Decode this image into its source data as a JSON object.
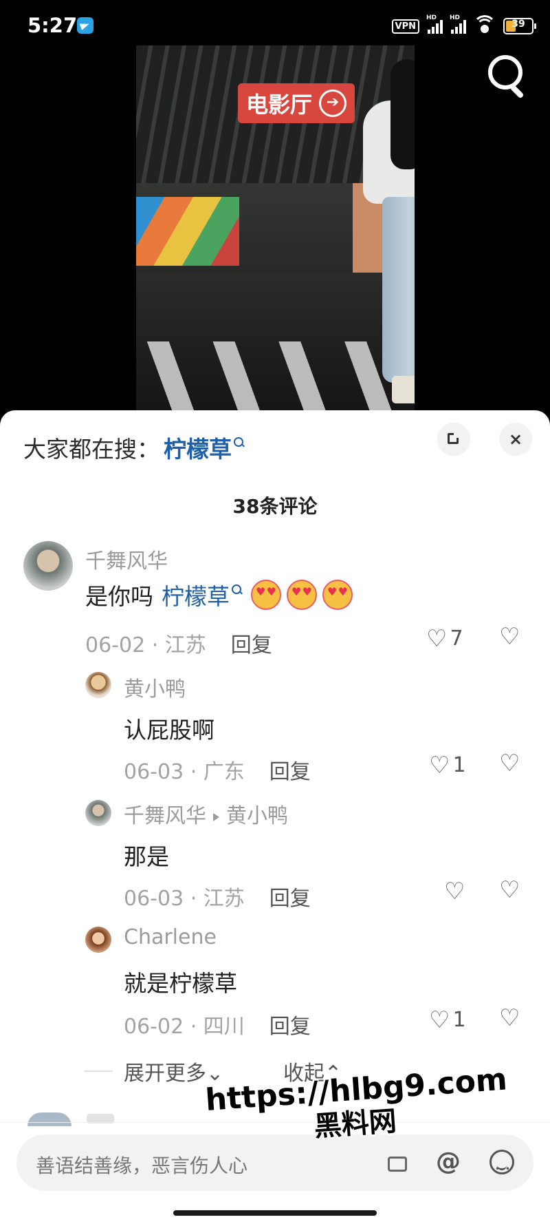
{
  "status_bar": {
    "time": "5:27",
    "vpn": "VPN",
    "hd": "HD",
    "battery": "39"
  },
  "video": {
    "sign_text": "电影厅",
    "sign_arrow": "➔"
  },
  "hot_search": {
    "prefix": "大家都在搜：",
    "term": "柠檬草"
  },
  "comments_header": {
    "count_label": "38条评论"
  },
  "comments": [
    {
      "author": "千舞风华",
      "text": "是你吗",
      "link": "柠檬草",
      "meta": "06-02 · 江苏",
      "reply": "回复",
      "likes": "7",
      "emoji_count": 3
    },
    {
      "author": "黄小鸭",
      "text": "认屁股啊",
      "meta": "06-03 · 广东",
      "reply": "回复",
      "likes": "1"
    },
    {
      "author": "千舞风华",
      "reply_to": "黄小鸭",
      "text": "那是",
      "meta": "06-03 · 江苏",
      "reply": "回复",
      "likes": ""
    },
    {
      "author": "Charlene",
      "text": "就是柠檬草",
      "meta": "06-02 · 四川",
      "reply": "回复",
      "likes": "1"
    }
  ],
  "thread_controls": {
    "expand_more": "展开更多⌄",
    "collapse": "收起⌃"
  },
  "input": {
    "placeholder": "善语结善缘，恶言伤人心",
    "at": "@"
  },
  "watermark": {
    "url": "https://hlbg9.com",
    "name": "黑料网"
  },
  "icons": {
    "search": "search-icon",
    "close": "×",
    "heart": "♡",
    "dislike": "♡"
  }
}
